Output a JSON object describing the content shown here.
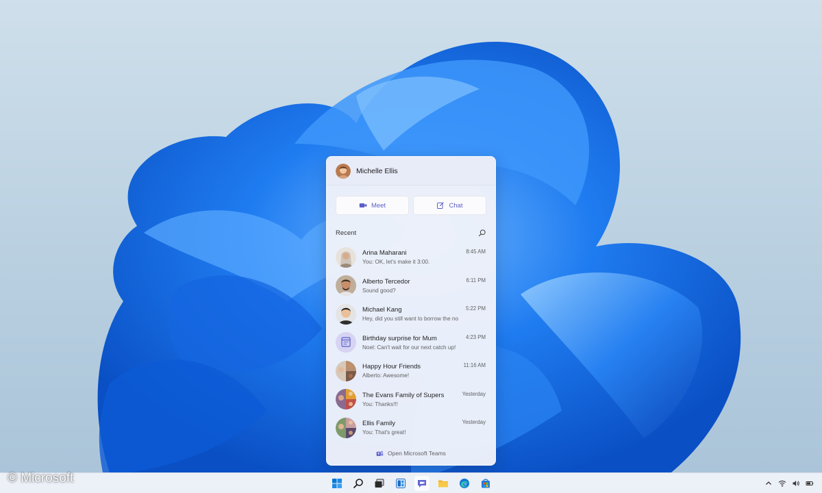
{
  "user": {
    "name": "Michelle Ellis"
  },
  "actions": {
    "meet_label": "Meet",
    "chat_label": "Chat"
  },
  "recent_label": "Recent",
  "chats": [
    {
      "name": "Arina Maharani",
      "preview": "You: OK, let's make it 3:00.",
      "time": "8:45 AM"
    },
    {
      "name": "Alberto Tercedor",
      "preview": "Sound good?",
      "time": "6:11 PM"
    },
    {
      "name": "Michael Kang",
      "preview": "Hey, did you still want to borrow the notes?",
      "time": "5:22 PM"
    },
    {
      "name": "Birthday surprise for Mum",
      "preview": "Noel: Can't wait for our next catch up!",
      "time": "4:23 PM"
    },
    {
      "name": "Happy Hour Friends",
      "preview": "Alberto: Awesome!",
      "time": "11:16 AM"
    },
    {
      "name": "The Evans Family of Supers",
      "preview": "You: Thanks!!!",
      "time": "Yesterday"
    },
    {
      "name": "Ellis Family",
      "preview": "You: That's great!",
      "time": "Yesterday"
    }
  ],
  "footer": {
    "label": "Open Microsoft Teams"
  },
  "watermark": "© Microsoft",
  "colors": {
    "accent": "#5b5fc7",
    "flyout_bg": "#f0f2fa",
    "taskbar_bg": "#eef2f8"
  },
  "taskbar_icons": [
    "windows-start-icon",
    "search-icon",
    "task-view-icon",
    "widgets-icon",
    "teams-chat-icon",
    "file-explorer-icon",
    "edge-icon",
    "store-icon"
  ],
  "tray_icons": [
    "chevron-up-icon",
    "wifi-icon",
    "volume-icon",
    "battery-icon"
  ]
}
